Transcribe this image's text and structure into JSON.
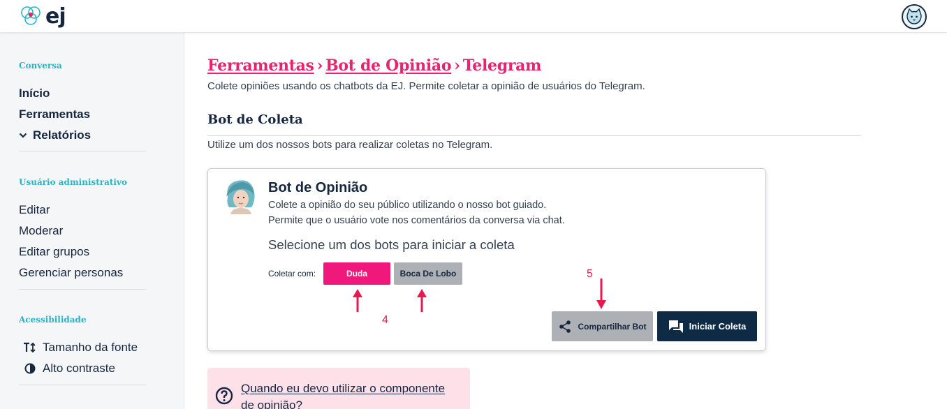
{
  "header": {
    "logo_text": "ej",
    "brand_color": "#16263f"
  },
  "sidebar": {
    "sections": [
      {
        "title": "Conversa",
        "items": [
          {
            "label": "Início"
          },
          {
            "label": "Ferramentas"
          },
          {
            "label": "Relatórios",
            "icon": "chevron-down-icon"
          }
        ]
      },
      {
        "title": "Usuário administrativo",
        "items": [
          {
            "label": "Editar"
          },
          {
            "label": "Moderar"
          },
          {
            "label": "Editar grupos"
          },
          {
            "label": "Gerenciar personas"
          }
        ]
      },
      {
        "title": "Acessibilidade",
        "items": [
          {
            "label": "Tamanho da fonte",
            "icon": "font-size-icon"
          },
          {
            "label": "Alto contraste",
            "icon": "contrast-icon"
          }
        ]
      }
    ]
  },
  "main": {
    "breadcrumb": [
      "Ferramentas",
      "Bot de Opinião",
      "Telegram"
    ],
    "subtitle": "Colete opiniões usando os chatbots da EJ. Permite coletar a opinião de usuários do Telegram.",
    "section_title": "Bot de Coleta",
    "section_desc": "Utilize um dos nossos bots para realizar coletas no Telegram.",
    "card": {
      "title": "Bot de Opinião",
      "line1": "Colete a opinião do seu público utilizando o nosso bot guiado.",
      "line2": "Permite que o usuário vote nos comentários da conversa via chat.",
      "select_text": "Selecione um dos bots para iniciar a coleta",
      "collect_label": "Coletar com:",
      "bots": [
        "Duda",
        "Boca De Lobo"
      ],
      "share_button": "Compartilhar Bot",
      "start_button": "Iniciar Coleta"
    },
    "annotations": [
      "4",
      "5"
    ],
    "help": {
      "text": "Quando eu devo utilizar o componente de opinião?"
    }
  },
  "colors": {
    "accent_pink": "#e6246f",
    "button_pink": "#f0187a",
    "navy": "#0e2a45",
    "sidebar_section": "#2ab4c3",
    "annotation_red": "#e8194f"
  }
}
